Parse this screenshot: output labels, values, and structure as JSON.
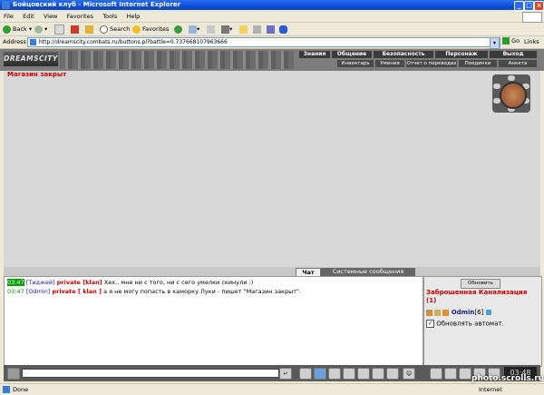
{
  "window": {
    "title": "Бойцовский клуб - Microsoft Internet Explorer",
    "min_glyph": "_",
    "max_glyph": "□",
    "close_glyph": "×"
  },
  "menubar": {
    "items": [
      "File",
      "Edit",
      "View",
      "Favorites",
      "Tools",
      "Help"
    ]
  },
  "toolbar": {
    "back_label": "Back",
    "search_label": "Search",
    "favorites_label": "Favorites"
  },
  "address": {
    "label": "Address",
    "url": "http://dreamscity.combats.ru/buttons.pl?battle=0.737668107963666",
    "go_label": "Go",
    "links_label": "Links"
  },
  "game": {
    "logo": "DREAMSCITY",
    "nav_top": [
      "Знания",
      "Общение",
      "Безопасность",
      "Персонаж",
      "Выход"
    ],
    "nav_bottom": [
      "Инвентарь",
      "Умения",
      "Отчет о переводах",
      "Поединки",
      "Анкета"
    ],
    "shop_status": "Магазин закрыт"
  },
  "chat": {
    "tabs": [
      "Чат",
      "Системные сообщения"
    ],
    "messages": [
      {
        "time": "03:47",
        "nick": "[Тиджей]",
        "channel": "private [klan]",
        "text": "Хех.. мне ни с того, ни с сего умелки скинули :)"
      },
      {
        "time": "03:47",
        "nick": "[Odmin]",
        "channel": "private [ klan ]",
        "text": "а я не могу попасть в каморку Луки - пишет \"Магазин закрыт\"."
      }
    ]
  },
  "room": {
    "refresh_label": "Обновить",
    "location": "Заброшенная Канализация (1)",
    "user_name": "Odmin",
    "user_level": "[6]",
    "auto_refresh_label": "Обновлять автомат."
  },
  "clock": "03:48",
  "status": {
    "left": "Done",
    "zone": "Internet"
  },
  "watermark": "photo.scrolls.ru"
}
